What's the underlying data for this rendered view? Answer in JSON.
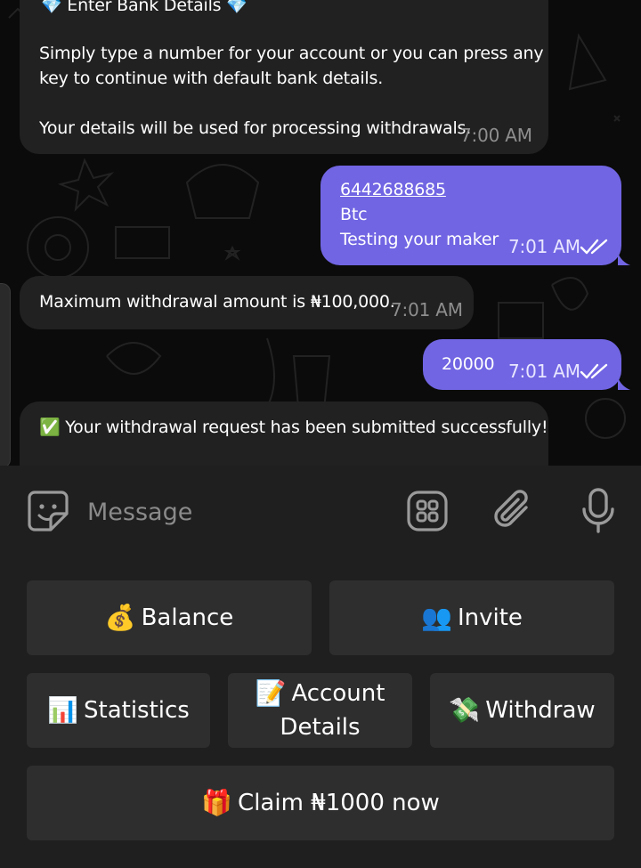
{
  "chat": {
    "messages": [
      {
        "direction": "in",
        "title": "💎 Enter Bank Details 💎",
        "line1": "Simply type a number for your account or you can press any",
        "line2": "key to continue with default bank details.",
        "line3": "Your details will be used for processing withdrawals.",
        "time": "7:00 AM"
      },
      {
        "direction": "out",
        "link": "6442688685",
        "line2": "Btc",
        "line3": "Testing your maker",
        "time": "7:01 AM",
        "status": "read"
      },
      {
        "direction": "in",
        "text": "Maximum withdrawal amount is ₦100,000.",
        "time": "7:01 AM"
      },
      {
        "direction": "out",
        "text": "20000",
        "time": "7:01 AM",
        "status": "read"
      },
      {
        "direction": "in",
        "text": "✅ Your withdrawal request has been submitted successfully!"
      }
    ]
  },
  "composer": {
    "placeholder": "Message",
    "icons": [
      "sticker-icon",
      "bot-menu-icon",
      "attach-icon",
      "microphone-icon"
    ]
  },
  "keyboard": {
    "balance": {
      "emoji": "💰",
      "label": "Balance"
    },
    "invite": {
      "emoji": "👥",
      "label": "Invite"
    },
    "statistics": {
      "emoji": "📊",
      "label": "Statistics"
    },
    "account": {
      "emoji": "📝",
      "label1": "Account",
      "label2": "Details"
    },
    "withdraw": {
      "emoji": "💸",
      "label": "Withdraw"
    },
    "claim": {
      "emoji": "🎁",
      "label": "Claim ₦1000 now"
    }
  },
  "colors": {
    "incoming_bubble": "#212121",
    "outgoing_bubble": "#7165e3",
    "keyboard_button": "#2e2e2e",
    "panel": "#1f1f1f"
  }
}
